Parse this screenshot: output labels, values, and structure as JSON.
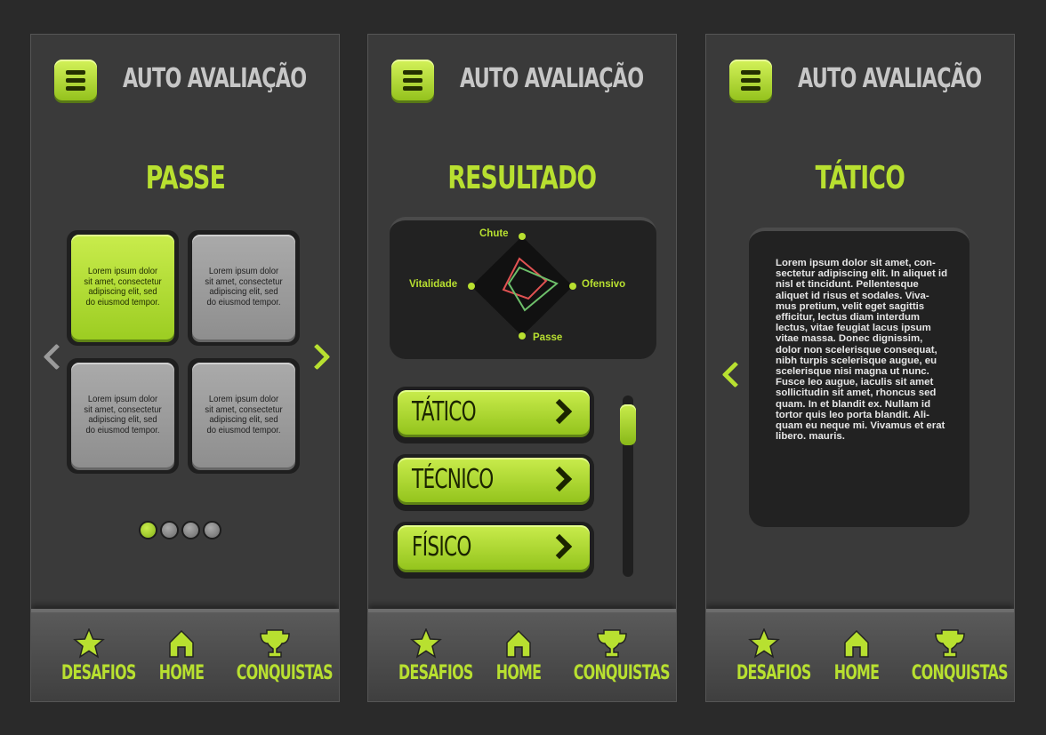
{
  "app_title": "AUTO AVALIAÇÃO",
  "nav": {
    "desafios": "DESAFIOS",
    "home": "HOME",
    "conquistas": "CONQUISTAS"
  },
  "screen1": {
    "title": "PASSE",
    "cards": [
      "Lorem ipsum dolor sit amet, consectetur adipiscing elit, sed do eiusmod tempor.",
      "Lorem ipsum dolor sit amet, consectetur adipiscing elit, sed do eiusmod tempor.",
      "Lorem ipsum dolor sit amet, consectetur adipiscing elit, sed do eiusmod tempor.",
      "Lorem ipsum dolor sit amet, consectetur adipiscing elit, sed do eiusmod tempor."
    ],
    "selected_card": 0,
    "page_count": 4,
    "current_page": 1
  },
  "screen2": {
    "title": "RESULTADO",
    "radar_axes": {
      "top": "Chute",
      "right": "Ofensivo",
      "bottom": "Passe",
      "left": "Vitalidade"
    },
    "categories": [
      "TÁTICO",
      "TÉCNICO",
      "FÍSICO"
    ]
  },
  "screen3": {
    "title": "TÁTICO",
    "body": "Lorem ipsum dolor sit amet, con-sectetur adipiscing elit. In aliquet id nisl et tincidunt. Pellentesque aliquet id risus et sodales. Viva-mus pretium, velit eget sagittis efficitur, lectus diam interdum lectus, vitae feugiat lacus ipsum vitae massa. Donec dignissim, dolor non scelerisque consequat, nibh turpis scelerisque augue, eu scelerisque nisi magna ut nunc. Fusce leo augue, iaculis sit amet sollicitudin sit amet, rhoncus sed quam. In et blandit ex. Nullam id tortor quis leo porta blandit. Ali-quam eu neque mi. Vivamus et erat libero. mauris."
  },
  "colors": {
    "accent": "#b8e030",
    "background": "#2a2a2a",
    "screen": "#3a3a3a"
  },
  "icons": [
    "menu-icon",
    "star-icon",
    "home-icon",
    "trophy-icon",
    "chevron-left-icon",
    "chevron-right-icon"
  ]
}
